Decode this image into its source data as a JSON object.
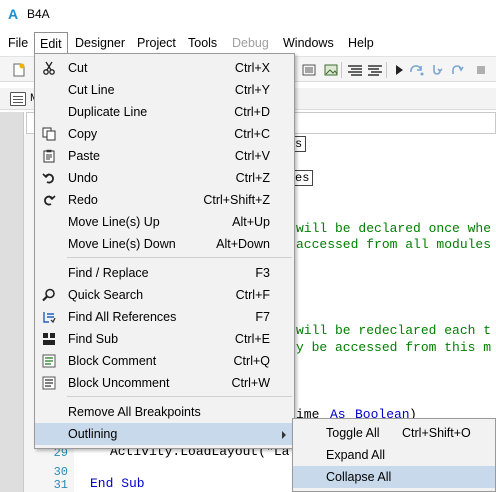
{
  "window": {
    "title": "B4A",
    "logo": "A"
  },
  "menubar": {
    "file": "File",
    "edit": "Edit",
    "designer": "Designer",
    "project": "Project",
    "tools": "Tools",
    "debug": "Debug",
    "windows": "Windows",
    "help": "Help"
  },
  "tab": {
    "label": "M"
  },
  "editor": {
    "boxed1": "s",
    "boxed2": "es",
    "comment1a": "will be declared once whe",
    "comment1b": "accessed from all modules",
    "comment2a": "will be redeclared each t",
    "comment2b": "y be accessed from this m",
    "line_partial_a": "ime",
    "line_partial_kw_as": "As",
    "line_partial_kw_bool": "Boolean",
    "line_partial_close": ")",
    "line29_num": "29",
    "line29_code": "Activity.LoadLayout(\"La",
    "line30_num": "30",
    "line31_num": "31",
    "line31_code": "End Sub"
  },
  "edit_menu": {
    "cut": {
      "label": "Cut",
      "shortcut": "Ctrl+X"
    },
    "cut_line": {
      "label": "Cut Line",
      "shortcut": "Ctrl+Y"
    },
    "duplicate_line": {
      "label": "Duplicate Line",
      "shortcut": "Ctrl+D"
    },
    "copy": {
      "label": "Copy",
      "shortcut": "Ctrl+C"
    },
    "paste": {
      "label": "Paste",
      "shortcut": "Ctrl+V"
    },
    "undo": {
      "label": "Undo",
      "shortcut": "Ctrl+Z"
    },
    "redo": {
      "label": "Redo",
      "shortcut": "Ctrl+Shift+Z"
    },
    "move_up": {
      "label": "Move Line(s) Up",
      "shortcut": "Alt+Up"
    },
    "move_down": {
      "label": "Move Line(s) Down",
      "shortcut": "Alt+Down"
    },
    "find_replace": {
      "label": "Find / Replace",
      "shortcut": "F3"
    },
    "quick_search": {
      "label": "Quick Search",
      "shortcut": "Ctrl+F"
    },
    "find_refs": {
      "label": "Find All References",
      "shortcut": "F7"
    },
    "find_sub": {
      "label": "Find Sub",
      "shortcut": "Ctrl+E"
    },
    "block_comment": {
      "label": "Block Comment",
      "shortcut": "Ctrl+Q"
    },
    "block_uncomment": {
      "label": "Block Uncomment",
      "shortcut": "Ctrl+W"
    },
    "remove_breakpoints": {
      "label": "Remove All Breakpoints"
    },
    "outlining": {
      "label": "Outlining"
    }
  },
  "outlining_submenu": {
    "toggle_all": {
      "label": "Toggle All",
      "shortcut": "Ctrl+Shift+O"
    },
    "expand_all": {
      "label": "Expand All"
    },
    "collapse_all": {
      "label": "Collapse All"
    }
  },
  "colors": {
    "comment": "#008000",
    "keyword": "#0000cc",
    "line_number": "#2a8bb0",
    "highlight": "#c9d9ec"
  }
}
